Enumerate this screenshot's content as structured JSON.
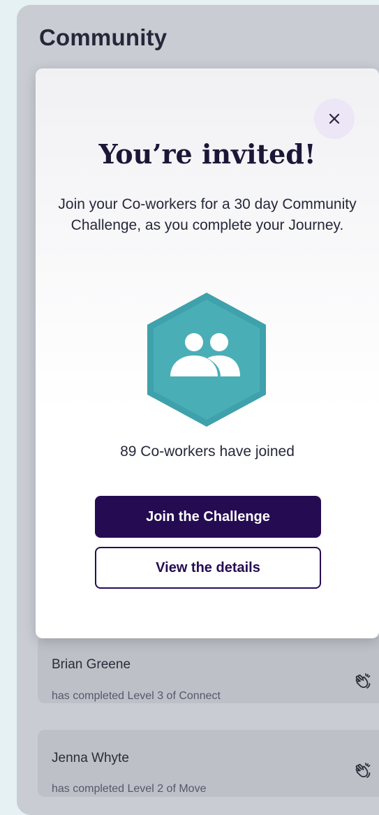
{
  "community": {
    "title": "Community",
    "feed": [
      {
        "name": "Brian Greene",
        "description": "has completed Level 3 of Connect",
        "reaction_icon": "clap-icon"
      },
      {
        "name": "Jenna Whyte",
        "description": "has completed Level 2 of Move",
        "reaction_icon": "clap-icon"
      }
    ]
  },
  "modal": {
    "close_icon": "close-icon",
    "title": "You’re invited!",
    "description": "Join your Co-workers for a 30 day Community Challenge, as you complete your Journey.",
    "badge_icon": "people-group-icon",
    "joined_text": "89 Co-workers have joined",
    "primary_button": "Join the Challenge",
    "secondary_button": "View the details"
  },
  "colors": {
    "primary": "#250c52",
    "badge_teal": "#4aaeb7",
    "background": "#e6f1f3"
  }
}
